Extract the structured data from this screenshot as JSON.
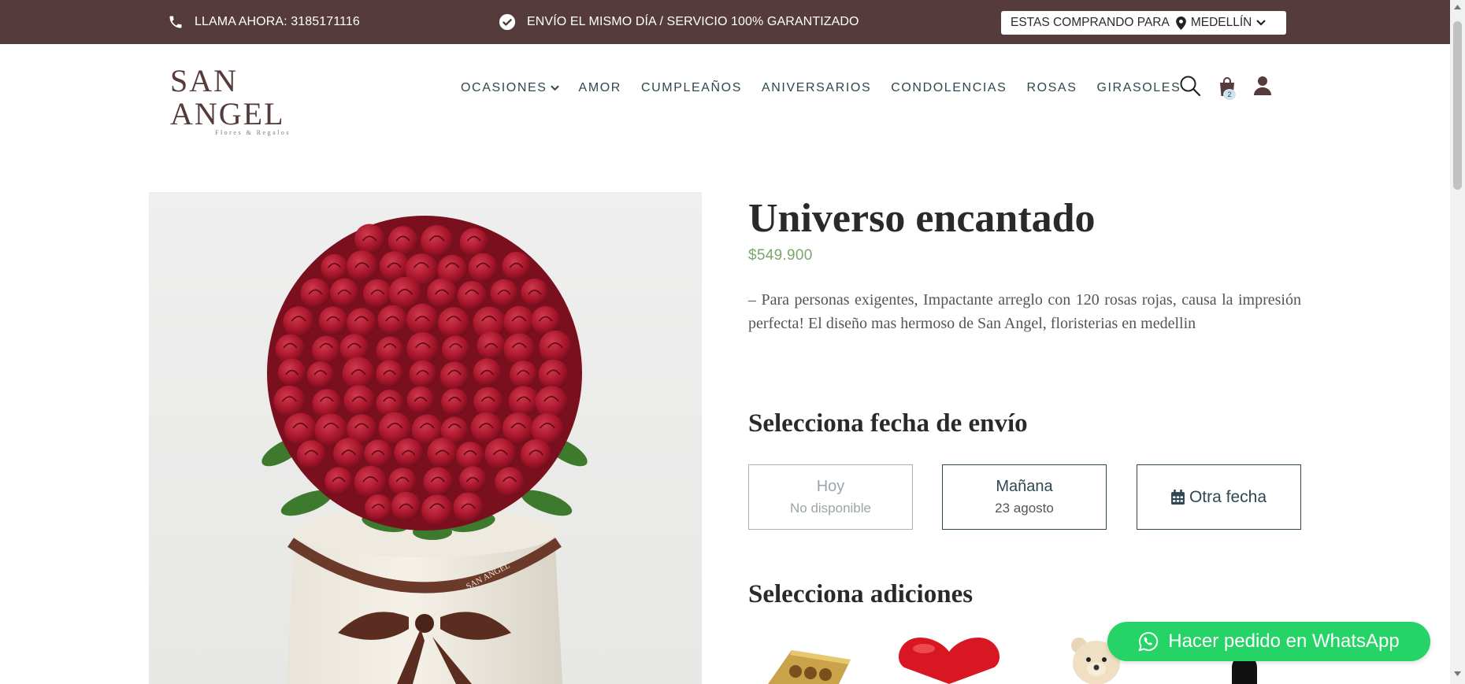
{
  "topbar": {
    "call_label": "LLAMA AHORA: 3185171116",
    "shipping_label": "ENVÍO EL MISMO DÍA / SERVICIO 100% GARANTIZADO",
    "city_prefix": "ESTAS COMPRANDO PARA",
    "city": "MEDELLÍN"
  },
  "brand": {
    "name": "SAN ANGEL",
    "tagline": "Flores & Regalos"
  },
  "nav": {
    "items": [
      "OCASIONES",
      "AMOR",
      "CUMPLEAÑOS",
      "ANIVERSARIOS",
      "CONDOLENCIAS",
      "ROSAS",
      "GIRASOLES"
    ]
  },
  "cart": {
    "count": "2"
  },
  "product": {
    "title": "Universo encantado",
    "price": "$549.900",
    "description": "– Para personas exigentes, Impactante arreglo con 120 rosas rojas, causa la impresión perfecta! El diseño mas hermoso de San Angel, floristerias en medellin",
    "image_alt": "Arreglo de 120 rosas rojas en caja",
    "box_brand": "SAN ANGEL"
  },
  "delivery": {
    "heading": "Selecciona fecha de envío",
    "options": [
      {
        "label": "Hoy",
        "sub": "No disponible",
        "available": false
      },
      {
        "label": "Mañana",
        "sub": "23 agosto",
        "available": true
      },
      {
        "label": "Otra fecha",
        "sub": "",
        "available": true
      }
    ]
  },
  "addons": {
    "heading": "Selecciona adiciones",
    "items": [
      "chocolates-icon",
      "heart-balloon-icon",
      "teddy-bear-icon",
      "wine-bottle-icon"
    ]
  },
  "whatsapp": {
    "label": "Hacer pedido en WhatsApp",
    "color": "#25d366"
  },
  "colors": {
    "topbar": "#553b3c",
    "accent_text": "#2f4750",
    "price": "#7aa66d"
  }
}
